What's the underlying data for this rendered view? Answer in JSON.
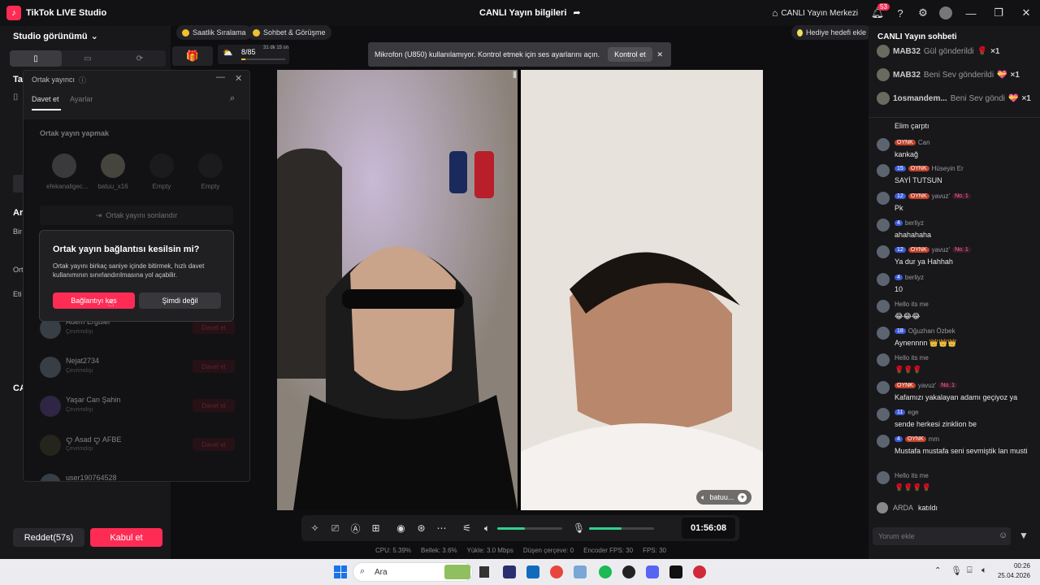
{
  "titlebar": {
    "app_title": "TikTok LIVE Studio",
    "center_title": "CANLI Yayın bilgileri",
    "live_center": "CANLI Yayın Merkezi",
    "notif_count": "53"
  },
  "left_panel": {
    "studio_view": "Studio görünümü",
    "section_ta": "Ta",
    "section_ar": "Ar",
    "section_bir": "Bir",
    "section_ort": "Ort",
    "section_eti": "Eti",
    "section_ca": "CA",
    "reject_label": "Reddet(57s)",
    "accept_label": "Kabul et"
  },
  "chips": {
    "ranking": "Saatlik Sıralama",
    "chat_meet": "Sohbet & Görüşme",
    "progress": "8/85",
    "progress_sub": "31 dk 15 sn",
    "progress_fraction": 0.094,
    "gift_goal": "Hediye hedefi ekle"
  },
  "notice": {
    "text": "Mikrofon (U850) kullanılamıyor. Kontrol etmek için ses ayarlarını açın.",
    "action": "Kontrol et"
  },
  "cohost": {
    "title": "Ortak yayıncı",
    "tab_invite": "Davet et",
    "tab_settings": "Ayarlar",
    "section_title": "Ortak yayın yapmak",
    "guests": [
      "efekanaligec...",
      "batuu_x16",
      "Empty",
      "Empty"
    ],
    "end_label": "Ortak yayını sonlandır",
    "invite_list": [
      {
        "name": "Adem Ergüler",
        "status": "Çevrimdışı",
        "btn": "Davet et"
      },
      {
        "name": "Nejat2734",
        "status": "Çevrimdışı",
        "btn": "Davet et"
      },
      {
        "name": "Yaşar Can Şahin",
        "status": "Çevrimdışı",
        "btn": "Davet et"
      },
      {
        "name": "ꨄ︎ Asad ꨄ︎ AFBE",
        "status": "Çevrimdışı",
        "btn": "Davet et"
      },
      {
        "name": "user190764528",
        "status": "",
        "btn": ""
      }
    ]
  },
  "dialog": {
    "title": "Ortak yayın bağlantısı kesilsin mi?",
    "body": "Ortak yayını birkaç saniye içinde bitirmek, hızlı davet kullanımının sınırlandırılmasına yol açabilir.",
    "confirm": "Bağlantıyı kes",
    "cancel": "Şimdi değil"
  },
  "video": {
    "guest_label": "batuu..."
  },
  "controls": {
    "timer": "01:56:08",
    "speaker_level": 0.42,
    "mic_level": 0.5
  },
  "stats": {
    "cpu": "CPU: 5.39%",
    "mem": "Bellek: 3.6%",
    "upload": "Yükle: 3.0 Mbps",
    "dropped": "Düşen çerçeve: 0",
    "encoder": "Encoder FPS: 30",
    "fps": "FPS: 30"
  },
  "chat": {
    "title": "CANLI Yayın sohbeti",
    "gifts": [
      {
        "user": "MAB32",
        "action": "Gül gönderildi",
        "count": "×1"
      },
      {
        "user": "MAB32",
        "action": "Beni Sev gönderildi",
        "count": "×1"
      },
      {
        "user": "1osmandem...",
        "action": "Beni Sev göndi",
        "count": "×1"
      }
    ],
    "messages": [
      {
        "lv": "",
        "fan": "",
        "name": "",
        "no1": "",
        "text": "Elim çarptı"
      },
      {
        "lv": "",
        "fan": "OYNK",
        "name": "Can",
        "no1": "",
        "text": "kankağ"
      },
      {
        "lv": "15",
        "fan": "OYNK",
        "name": "Hüseyin Er",
        "no1": "",
        "text": "SAYİ TUTSUN"
      },
      {
        "lv": "12",
        "fan": "OYNK",
        "name": "yavuz'",
        "no1": "No. 1",
        "text": "Pk"
      },
      {
        "lv": "4",
        "fan": "",
        "name": "berliyz",
        "no1": "",
        "text": "ahahahaha"
      },
      {
        "lv": "12",
        "fan": "OYNK",
        "name": "yavuz'",
        "no1": "No. 1",
        "text": "Ya dur ya Hahhah"
      },
      {
        "lv": "4",
        "fan": "",
        "name": "berliyz",
        "no1": "",
        "text": "10"
      },
      {
        "lv": "",
        "fan": "",
        "name": "Hello its me",
        "no1": "",
        "text": "😂😂😂"
      },
      {
        "lv": "18",
        "fan": "",
        "name": "Oğuzhan Özbek",
        "no1": "",
        "text": "Aynennnn 👑👑👑"
      },
      {
        "lv": "",
        "fan": "",
        "name": "Hello its me",
        "no1": "",
        "text": "🌹🌹🌹"
      },
      {
        "lv": "",
        "fan": "OYNK",
        "name": "yavuz'",
        "no1": "No. 1",
        "text": "Kafamızı yakalayan adamı geçiyoz ya"
      },
      {
        "lv": "11",
        "fan": "",
        "name": "ege",
        "no1": "",
        "text": "sende herkesi zinklion be"
      },
      {
        "lv": "4",
        "fan": "OYNK",
        "name": "mm",
        "no1": "",
        "text": "Mustafa mustafa seni sevmiştik lan musti"
      },
      {
        "lv": "",
        "fan": "",
        "name": "Hello its me",
        "no1": "",
        "text": "🌹🌹🌹🌹"
      }
    ],
    "join_user": "ARDA",
    "join_text": "katıldı",
    "input_placeholder": "Yorum ekle"
  },
  "taskbar": {
    "search": "Ara",
    "time": "00:26",
    "date": "25.04.2026"
  }
}
